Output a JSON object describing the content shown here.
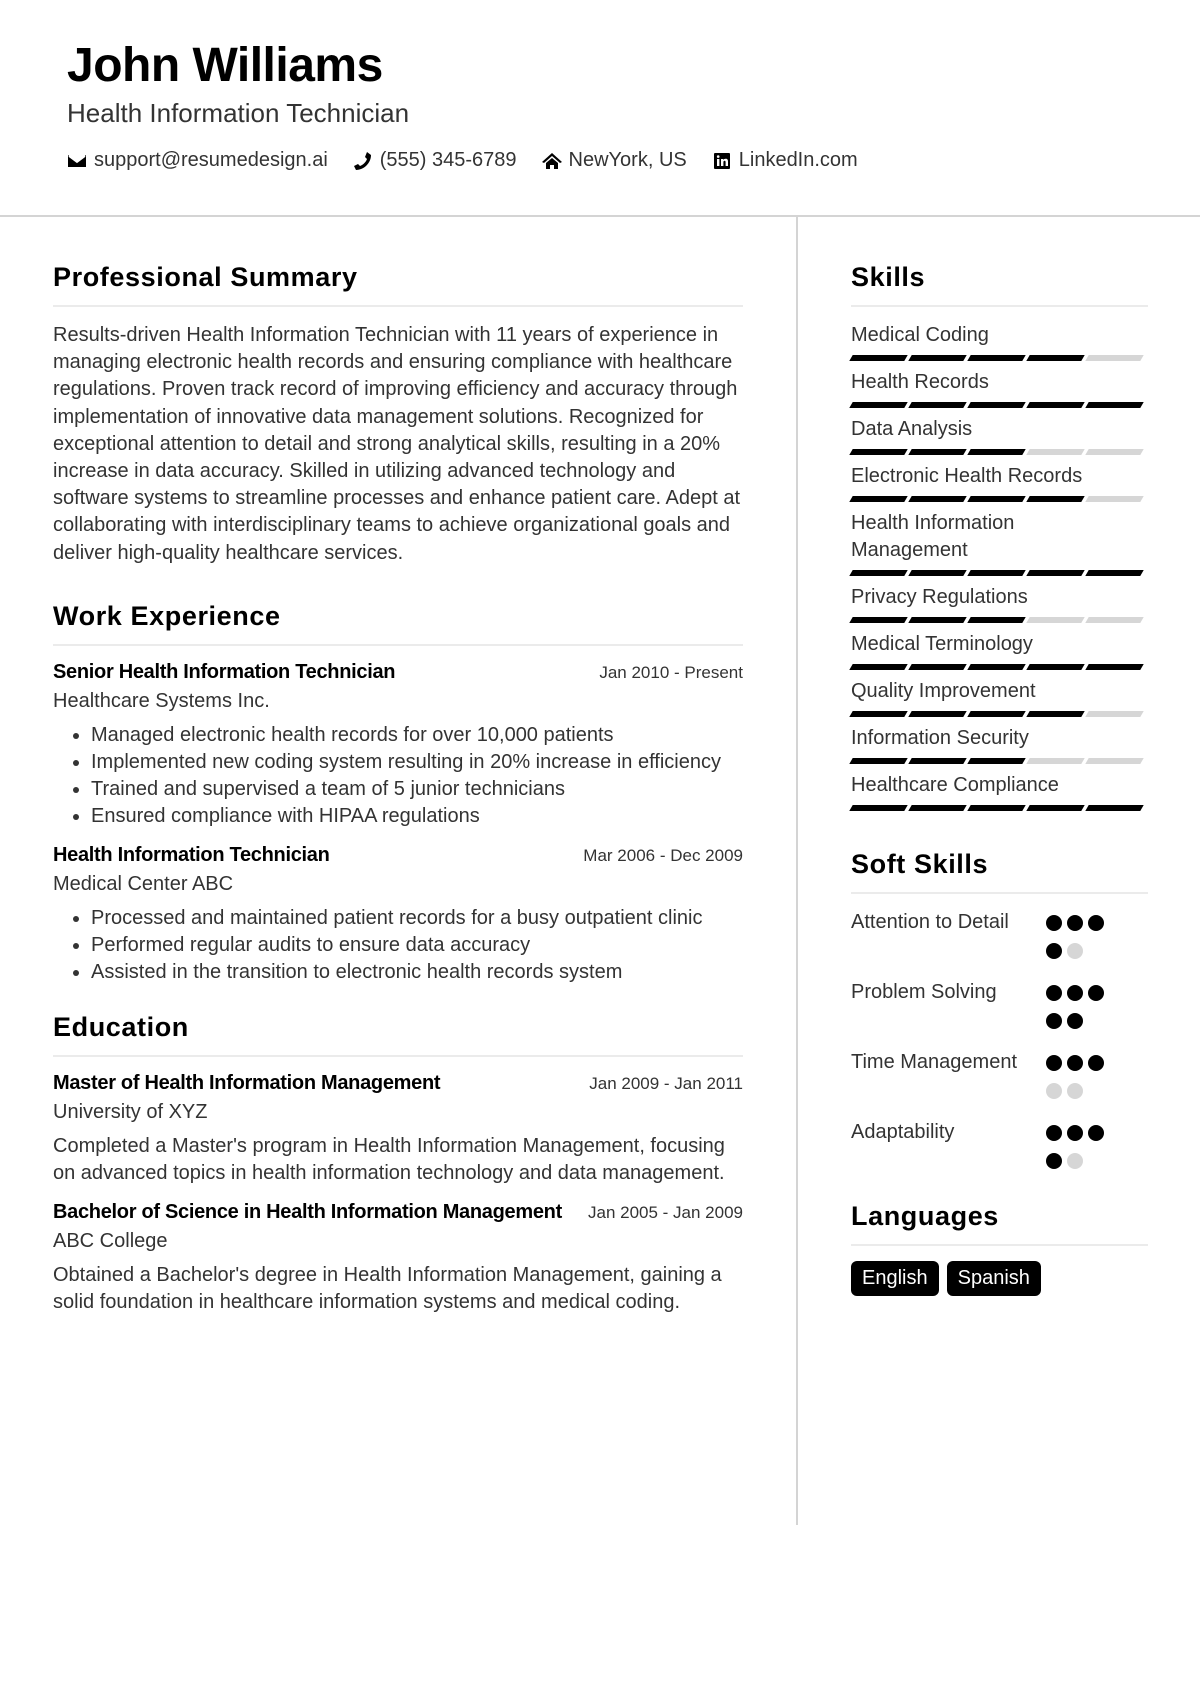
{
  "header": {
    "name": "John Williams",
    "title": "Health Information Technician",
    "contacts": [
      {
        "icon": "envelope-icon",
        "text": "support@resumedesign.ai"
      },
      {
        "icon": "phone-icon",
        "text": "(555) 345-6789"
      },
      {
        "icon": "home-icon",
        "text": "NewYork, US"
      },
      {
        "icon": "linkedin-icon",
        "text": "LinkedIn.com"
      }
    ]
  },
  "summary": {
    "heading": "Professional Summary",
    "text": "Results-driven Health Information Technician with 11 years of experience in managing electronic health records and ensuring compliance with healthcare regulations. Proven track record of improving efficiency and accuracy through implementation of innovative data management solutions. Recognized for exceptional attention to detail and strong analytical skills, resulting in a 20% increase in data accuracy. Skilled in utilizing advanced technology and software systems to streamline processes and enhance patient care. Adept at collaborating with interdisciplinary teams to achieve organizational goals and deliver high-quality healthcare services."
  },
  "work": {
    "heading": "Work Experience",
    "jobs": [
      {
        "role": "Senior Health Information Technician",
        "date": "Jan 2010 - Present",
        "org": "Healthcare Systems Inc.",
        "bullets": [
          "Managed electronic health records for over 10,000 patients",
          "Implemented new coding system resulting in 20% increase in efficiency",
          "Trained and supervised a team of 5 junior technicians",
          "Ensured compliance with HIPAA regulations"
        ]
      },
      {
        "role": "Health Information Technician",
        "date": "Mar 2006 - Dec 2009",
        "org": "Medical Center ABC",
        "bullets": [
          "Processed and maintained patient records for a busy outpatient clinic",
          "Performed regular audits to ensure data accuracy",
          "Assisted in the transition to electronic health records system"
        ]
      }
    ]
  },
  "education": {
    "heading": "Education",
    "items": [
      {
        "degree": "Master of Health Information Management",
        "date": "Jan 2009 - Jan 2011",
        "school": "University of XYZ",
        "desc": "Completed a Master's program in Health Information Management, focusing on advanced topics in health information technology and data management."
      },
      {
        "degree": "Bachelor of Science in Health Information Management",
        "date": "Jan 2005 - Jan 2009",
        "school": "ABC College",
        "desc": "Obtained a Bachelor's degree in Health Information Management, gaining a solid foundation in healthcare information systems and medical coding."
      }
    ]
  },
  "skills": {
    "heading": "Skills",
    "max_level": 5,
    "items": [
      {
        "name": "Medical Coding",
        "level": 4
      },
      {
        "name": "Health Records",
        "level": 5
      },
      {
        "name": "Data Analysis",
        "level": 3
      },
      {
        "name": "Electronic Health Records",
        "level": 4
      },
      {
        "name": "Health Information Management",
        "level": 5
      },
      {
        "name": "Privacy Regulations",
        "level": 3
      },
      {
        "name": "Medical Terminology",
        "level": 5
      },
      {
        "name": "Quality Improvement",
        "level": 4
      },
      {
        "name": "Information Security",
        "level": 3
      },
      {
        "name": "Healthcare Compliance",
        "level": 5
      }
    ]
  },
  "soft_skills": {
    "heading": "Soft Skills",
    "max_level": 5,
    "items": [
      {
        "name": "Attention to Detail",
        "level": 4
      },
      {
        "name": "Problem Solving",
        "level": 5
      },
      {
        "name": "Time Management",
        "level": 3
      },
      {
        "name": "Adaptability",
        "level": 4
      }
    ]
  },
  "languages": {
    "heading": "Languages",
    "items": [
      "English",
      "Spanish"
    ]
  }
}
